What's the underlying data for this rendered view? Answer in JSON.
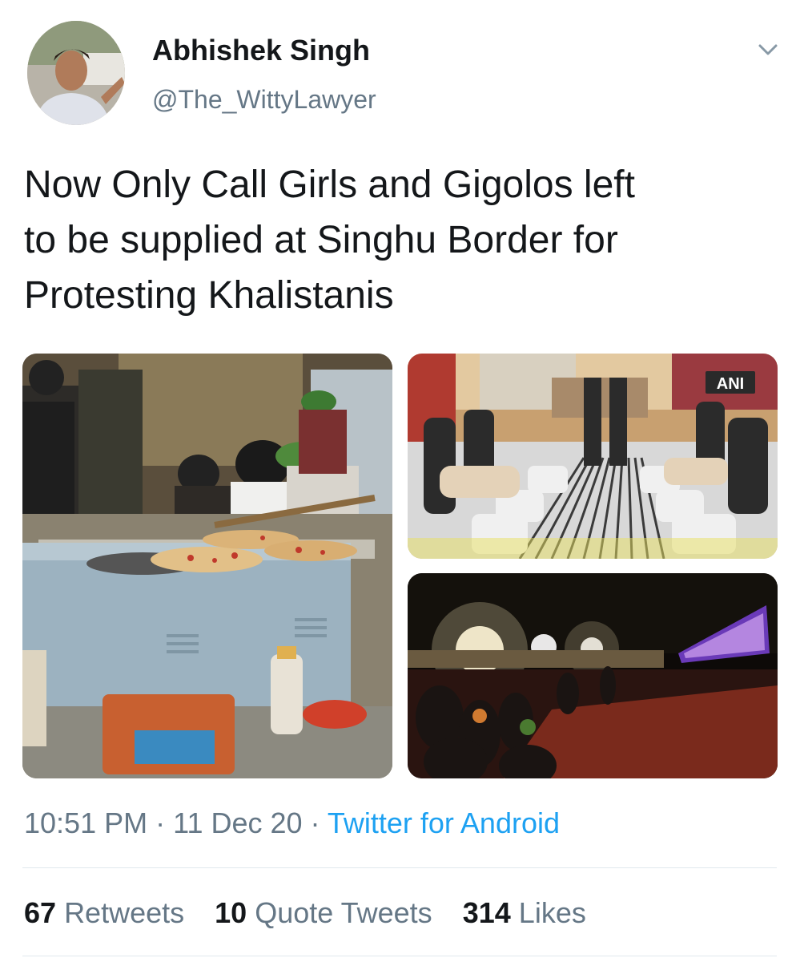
{
  "author": {
    "name": "Abhishek Singh",
    "handle": "@The_WittyLawyer"
  },
  "tweet": {
    "lines": [
      "Now Only Call Girls and Gigolos left",
      "to be supplied at Singhu Border for",
      "Protesting Khalistanis"
    ]
  },
  "media": {
    "watermark": "ANI"
  },
  "meta": {
    "time": "10:51 PM",
    "sep1": " · ",
    "date": "11 Dec 20",
    "sep2": " · ",
    "source": "Twitter for Android"
  },
  "stats": {
    "retweets_count": "67",
    "retweets_label": "Retweets",
    "quotes_count": "10",
    "quotes_label": "Quote Tweets",
    "likes_count": "314",
    "likes_label": "Likes"
  },
  "icons": {
    "menu": "chevron-down-icon"
  },
  "colors": {
    "primary_text": "#14171a",
    "secondary_text": "#657786",
    "link": "#1da1f2",
    "divider": "#e1e8ed"
  }
}
